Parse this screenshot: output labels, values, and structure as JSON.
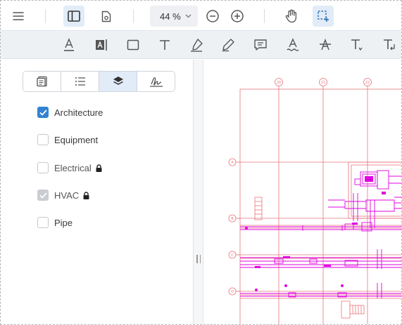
{
  "toolbar": {
    "zoom_value": "44 %",
    "icons": [
      "menu-icon",
      "panel-toggle-icon",
      "document-settings-icon",
      "zoom-out-icon",
      "zoom-in-icon",
      "pan-hand-icon",
      "marquee-select-icon"
    ]
  },
  "annotation_tools": [
    "underline-icon",
    "text-highlight-icon",
    "rectangle-icon",
    "free-text-icon",
    "freehand-highlighter-icon",
    "pen-icon",
    "comment-icon",
    "squiggly-icon",
    "strikeout-icon",
    "replace-text-icon",
    "insert-text-icon"
  ],
  "left_panel": {
    "tabs": [
      "thumbnails-icon",
      "outline-list-icon",
      "layers-icon",
      "signature-icon"
    ],
    "active_tab": "layers",
    "layers": [
      {
        "label": "Architecture",
        "checked": true,
        "locked": false
      },
      {
        "label": "Equipment",
        "checked": false,
        "locked": false
      },
      {
        "label": "Electrical",
        "checked": false,
        "locked": true
      },
      {
        "label": "HVAC",
        "checked": true,
        "locked": true
      },
      {
        "label": "Pipe",
        "checked": false,
        "locked": false
      }
    ]
  },
  "drawing": {
    "grid_column_labels": [
      "20",
      "21",
      "22"
    ],
    "grid_row_labels": [
      "A",
      "B",
      "C",
      "D"
    ]
  },
  "colors": {
    "accent": "#3183d2",
    "active_bg": "#e1ecf8",
    "architecture_lines": "#e8747c",
    "hvac_lines": "#e000e0"
  }
}
